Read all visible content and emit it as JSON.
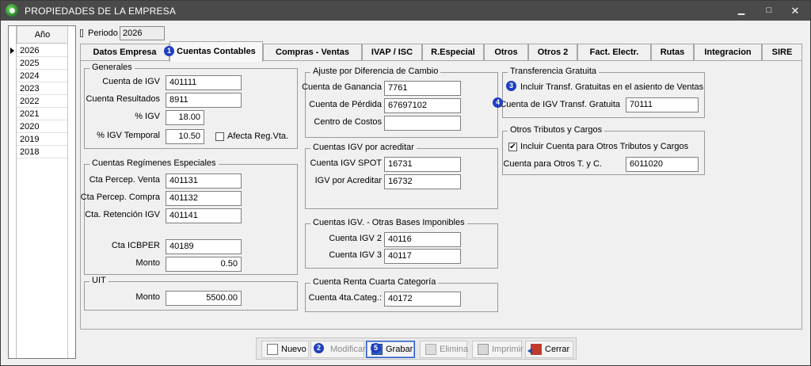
{
  "window": {
    "title": "PROPIEDADES DE LA EMPRESA",
    "min": "▁",
    "max": "□",
    "close": "✕"
  },
  "years": {
    "header": "Año",
    "items": [
      "2026",
      "2025",
      "2024",
      "2023",
      "2022",
      "2021",
      "2020",
      "2019",
      "2018"
    ]
  },
  "periodo": {
    "label": "Periodo",
    "value": "2026"
  },
  "tabs": [
    "Datos Empresa",
    "Cuentas Contables",
    "Compras - Ventas",
    "IVAP / ISC",
    "R.Especial",
    "Otros",
    "Otros 2",
    "Fact. Electr.",
    "Rutas",
    "Integracion",
    "SIRE"
  ],
  "badges": [
    "1",
    "2",
    "3",
    "4",
    "5"
  ],
  "generales": {
    "title": "Generales",
    "cuenta_igv_label": "Cuenta de IGV",
    "cuenta_igv": "401111",
    "cuenta_res_label": "Cuenta Resultados",
    "cuenta_res": "8911",
    "pct_igv_label": "% IGV",
    "pct_igv": "18.00",
    "pct_igv_temp_label": "% IGV Temporal",
    "pct_igv_temp": "10.50",
    "afecta_label": "Afecta Reg.Vta."
  },
  "regimenes": {
    "title": "Cuentas Regímenes Especiales",
    "perc_venta_label": "Cta Percep. Venta",
    "perc_venta": "401131",
    "perc_compra_label": "Cta Percep. Compra",
    "perc_compra": "401132",
    "retencion_label": "Cta. Retención IGV",
    "retencion": "401141",
    "icbper_label": "Cta ICBPER",
    "icbper": "40189",
    "monto_label": "Monto",
    "monto": "0.50"
  },
  "uit": {
    "title": "UIT",
    "monto_label": "Monto",
    "monto": "5500.00"
  },
  "ajuste": {
    "title": "Ajuste por Diferencia de Cambio",
    "ganancia_label": "Cuenta de Ganancia",
    "ganancia": "7761",
    "perdida_label": "Cuenta de Pérdida",
    "perdida": "67697102",
    "costos_label": "Centro de Costos",
    "costos": ""
  },
  "igv_acreditar": {
    "title": "Cuentas IGV por acreditar",
    "spot_label": "Cuenta IGV SPOT",
    "spot": "16731",
    "igv_label": "IGV por Acreditar",
    "igv": "16732"
  },
  "otras_bases": {
    "title": "Cuentas IGV. - Otras Bases Imponibles",
    "igv2_label": "Cuenta IGV 2",
    "igv2": "40116",
    "igv3_label": "Cuenta IGV 3",
    "igv3": "40117"
  },
  "renta": {
    "title": "Cuenta Renta Cuarta Categoría",
    "cuenta_label": "Cuenta 4ta.Categ.:",
    "cuenta": "40172"
  },
  "transferencia": {
    "title": "Transferencia Gratuita",
    "incluir_label": "Incluir Transf. Gratuitas en el asiento de Ventas",
    "cuenta_label": "Cuenta de IGV Transf. Gratuita",
    "cuenta": "70111"
  },
  "otros_tributos": {
    "title": "Otros Tributos y Cargos",
    "incluir_label": "Incluir Cuenta para Otros Tributos y Cargos",
    "incluir_checked": "✔",
    "cuenta_label": "Cuenta para Otros T. y C.",
    "cuenta": "6011020"
  },
  "toolbar": {
    "nuevo": "Nuevo",
    "modificar": "Modificar",
    "grabar": "Grabar",
    "elimina": "Elimina",
    "imprimir": "Imprimir",
    "cerrar": "Cerrar"
  }
}
